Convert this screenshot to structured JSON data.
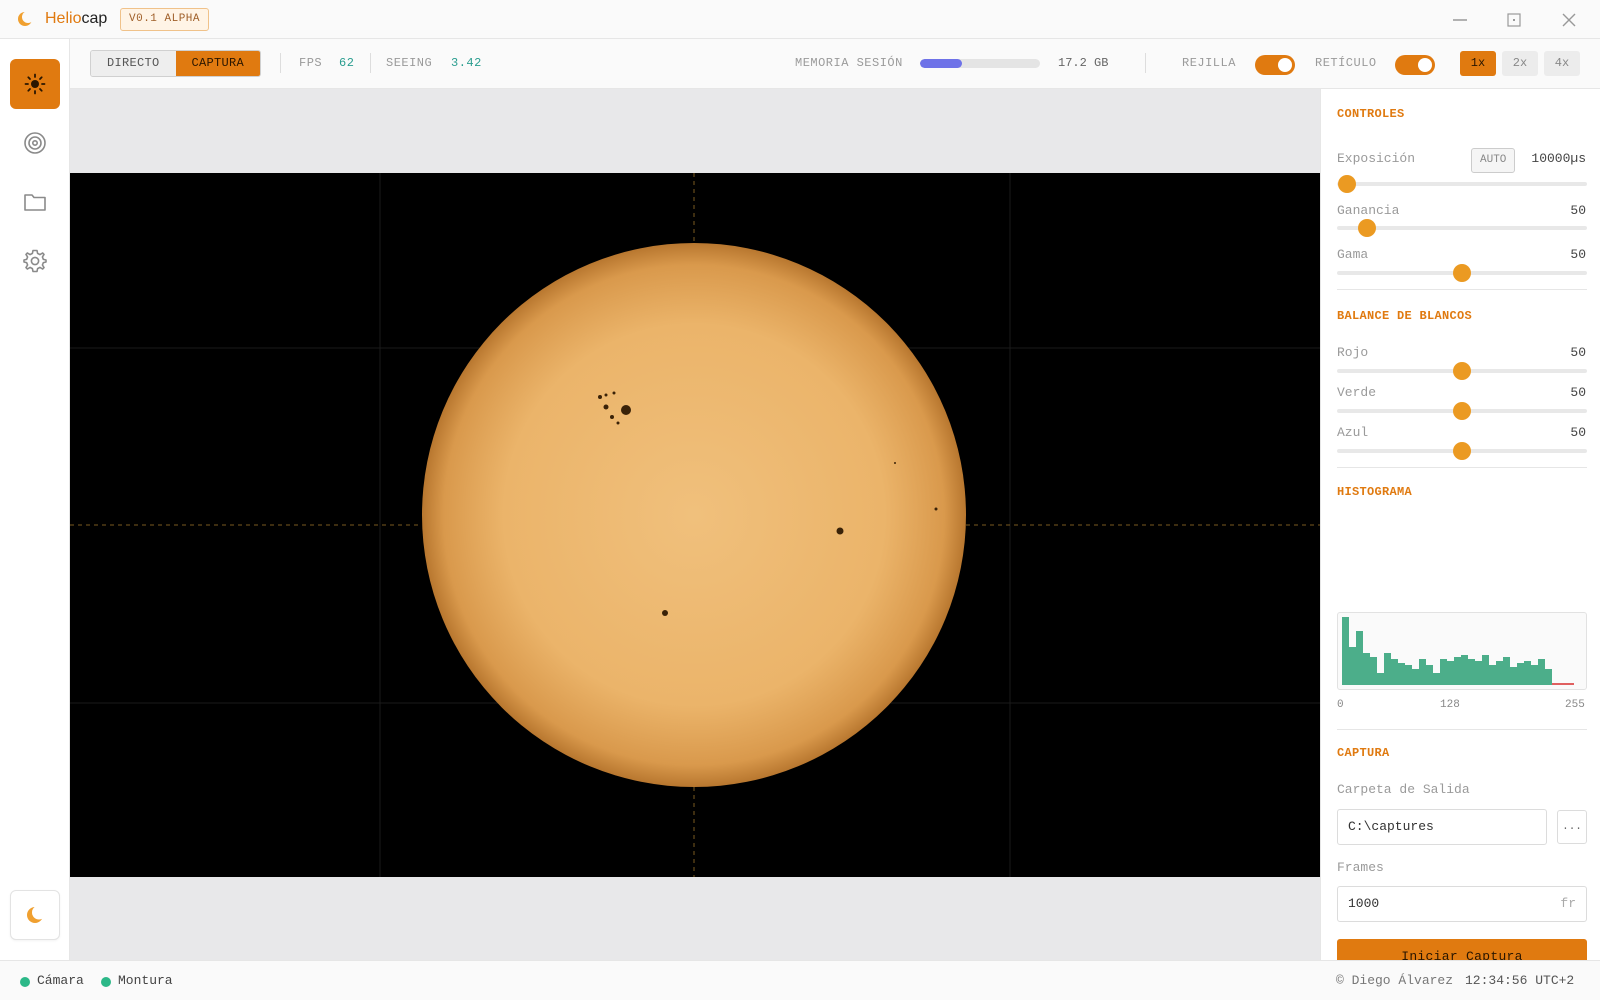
{
  "app": {
    "name_part1": "Helio",
    "name_part2": "cap",
    "version": "V0.1 ALPHA"
  },
  "nav": {
    "items": [
      {
        "icon": "sun-icon",
        "active": true
      },
      {
        "icon": "target-icon",
        "active": false
      },
      {
        "icon": "folder-icon",
        "active": false
      },
      {
        "icon": "gear-icon",
        "active": false
      }
    ],
    "theme_icon": "moon-icon"
  },
  "toolbar": {
    "mode_live": "DIRECTO",
    "mode_capture": "CAPTURA",
    "fps_label": "FPS",
    "fps_value": "62",
    "seeing_label": "SEEING",
    "seeing_value": "3.42",
    "memory_label": "MEMORIA SESIÓN",
    "memory_fraction": 0.35,
    "memory_value": "17.2 GB",
    "grid_label": "REJILLA",
    "grid_on": true,
    "reticle_label": "RETÍCULO",
    "reticle_on": true,
    "zoom_options": [
      "1x",
      "2x",
      "4x"
    ],
    "zoom_selected": "1x"
  },
  "panel": {
    "controls_title": "CONTROLES",
    "exposure_label": "Exposición",
    "auto_label": "AUTO",
    "exposure_value": "10000µs",
    "exposure_fraction": 0.04,
    "gain_label": "Ganancia",
    "gain_value": "50",
    "gain_fraction": 0.12,
    "gamma_label": "Gama",
    "gamma_value": "50",
    "gamma_fraction": 0.5,
    "wb_title": "BALANCE DE BLANCOS",
    "red_label": "Rojo",
    "red_value": "50",
    "green_label": "Verde",
    "green_value": "50",
    "blue_label": "Azul",
    "blue_value": "50",
    "histogram_title": "HISTOGRAMA",
    "histogram_ticks": [
      "0",
      "128",
      "255"
    ],
    "capture_title": "CAPTURA",
    "output_folder_label": "Carpeta de Salida",
    "output_folder_value": "C:\\captures",
    "browse_label": "...",
    "frames_label": "Frames",
    "frames_value": "1000",
    "frames_unit": "fr",
    "start_label": "Iniciar Captura"
  },
  "status": {
    "camera_label": "Cámara",
    "mount_label": "Montura",
    "author": "© Diego Álvarez",
    "clock": "12:34:56 UTC+2"
  },
  "colors": {
    "accent": "#e07a10",
    "status_ok": "#2cb888",
    "memory_bar": "#6e72e8",
    "histogram": "#4cae8a"
  }
}
